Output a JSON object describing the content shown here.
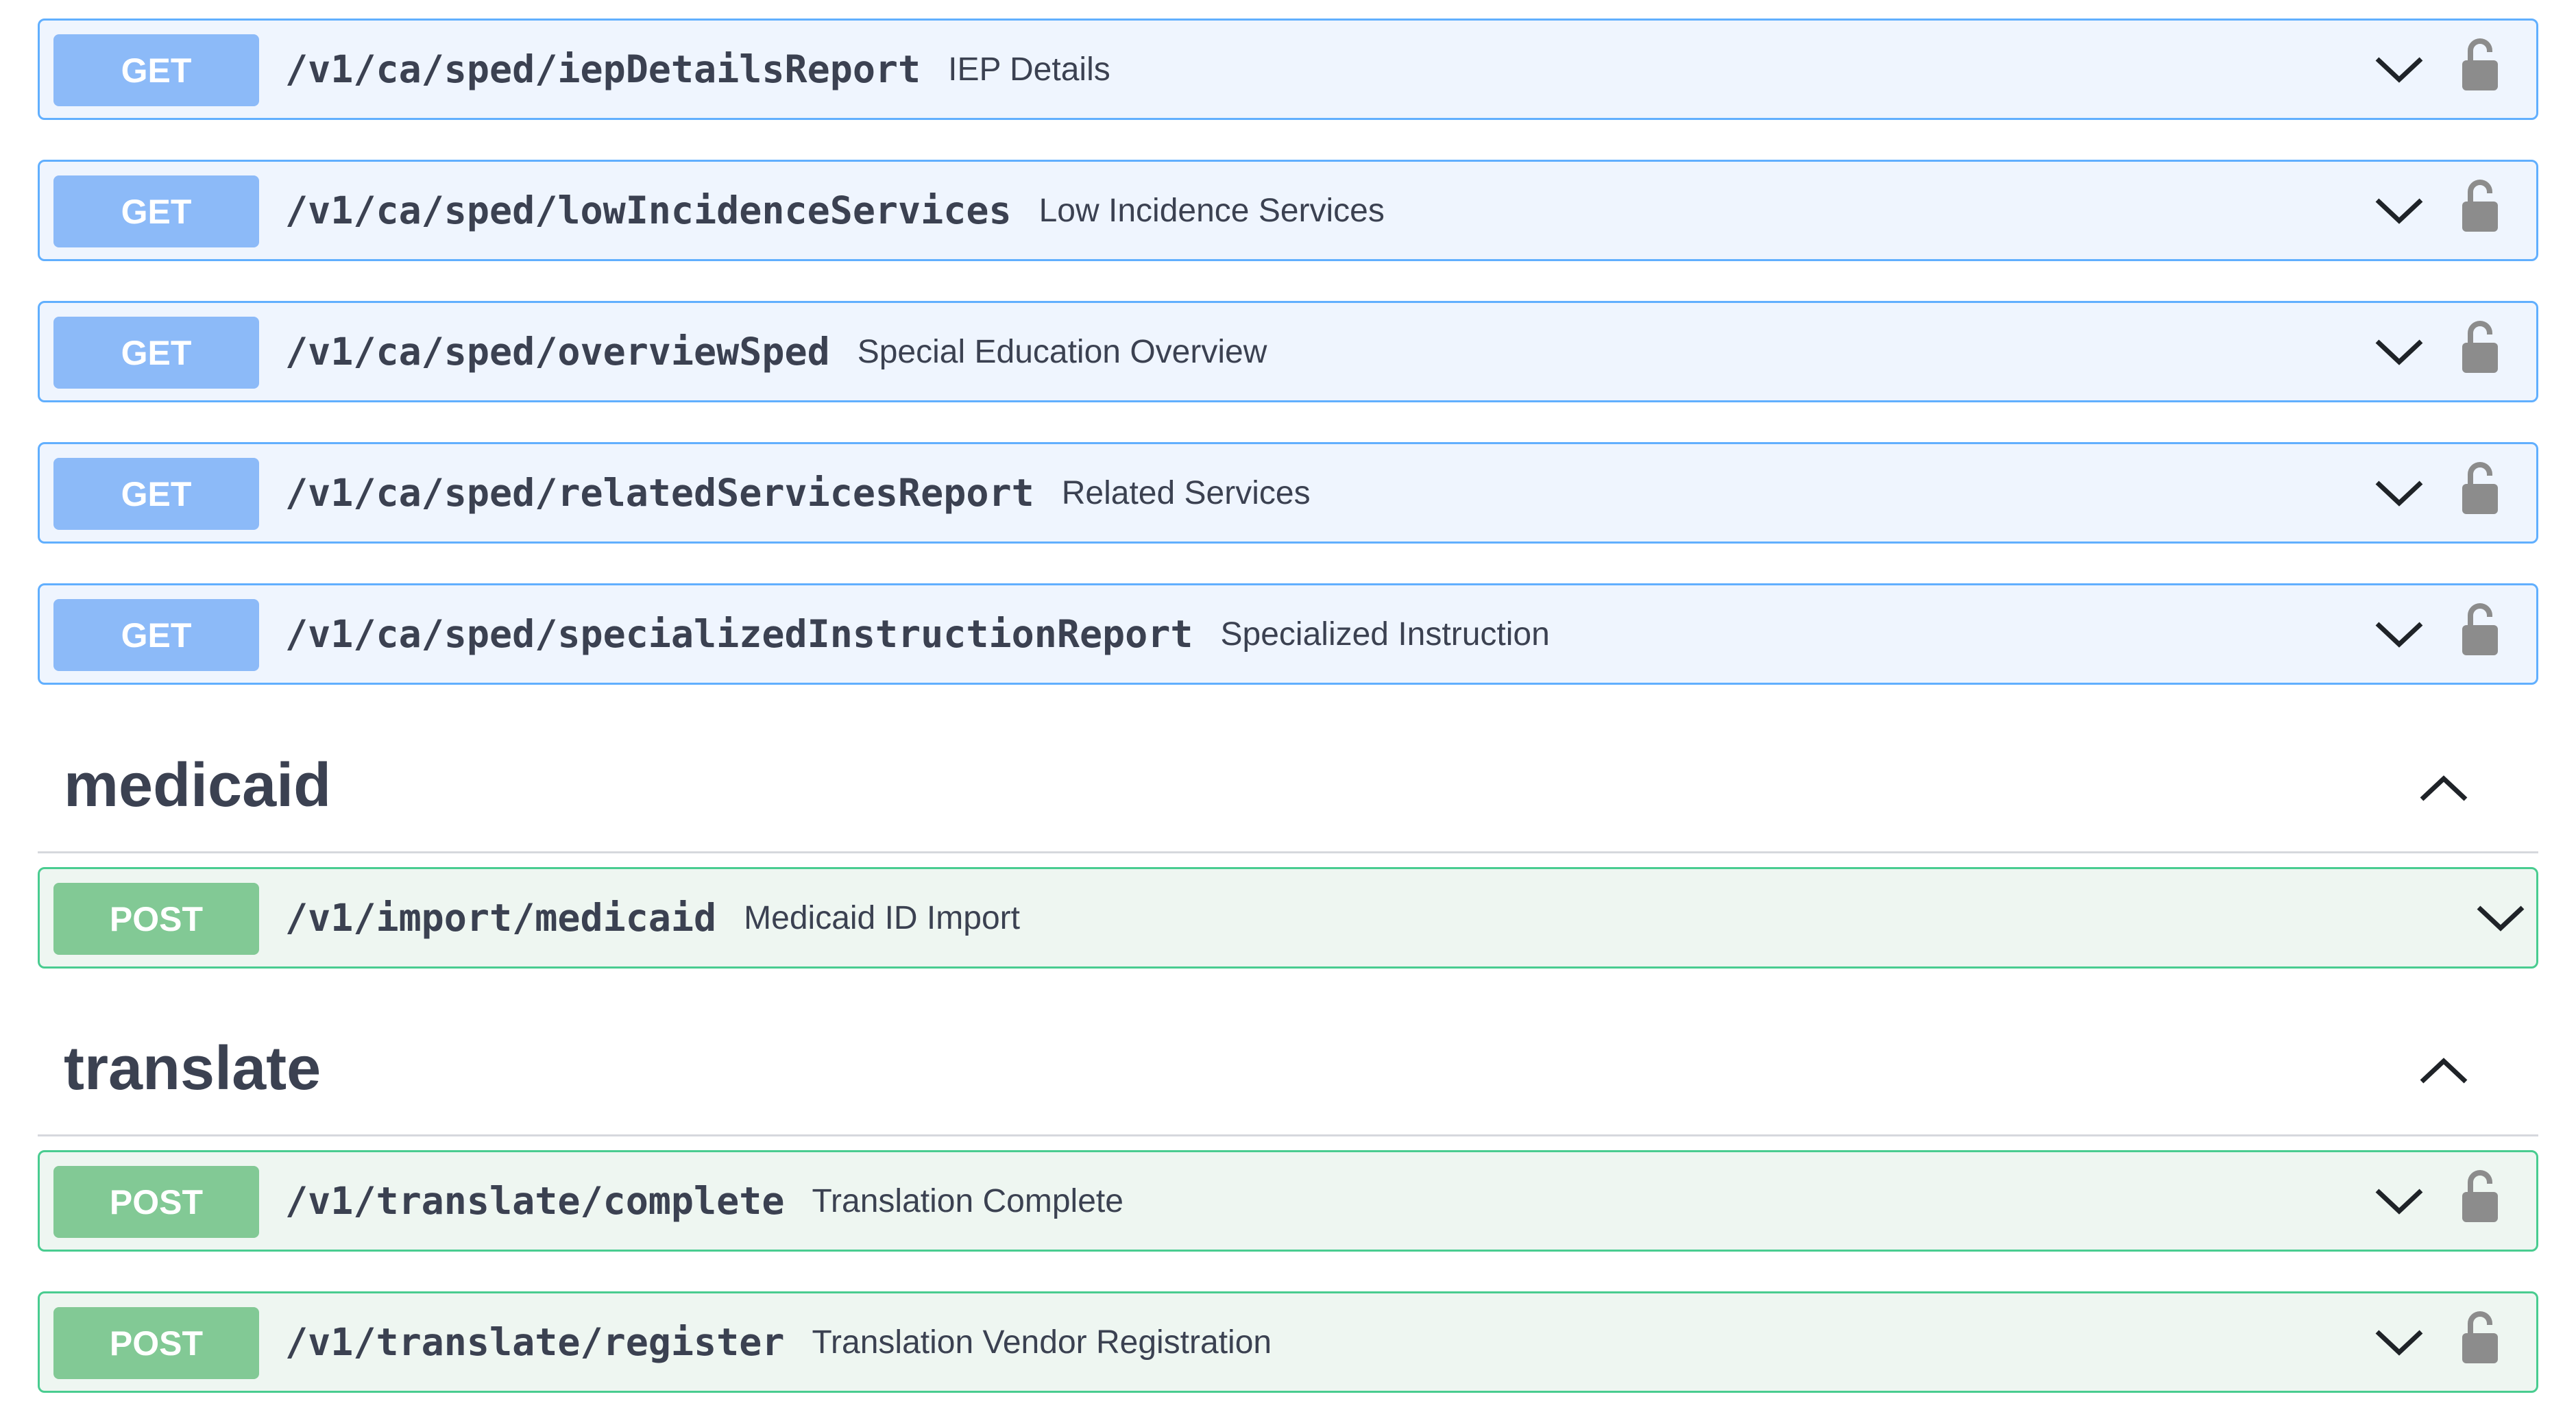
{
  "operations_top": [
    {
      "method": "GET",
      "path": "/v1/ca/sped/iepDetailsReport",
      "summary": "IEP Details",
      "locked": true
    },
    {
      "method": "GET",
      "path": "/v1/ca/sped/lowIncidenceServices",
      "summary": "Low Incidence Services",
      "locked": true
    },
    {
      "method": "GET",
      "path": "/v1/ca/sped/overviewSped",
      "summary": "Special Education Overview",
      "locked": true
    },
    {
      "method": "GET",
      "path": "/v1/ca/sped/relatedServicesReport",
      "summary": "Related Services",
      "locked": true
    },
    {
      "method": "GET",
      "path": "/v1/ca/sped/specializedInstructionReport",
      "summary": "Specialized Instruction",
      "locked": true
    }
  ],
  "sections": [
    {
      "title": "medicaid",
      "expanded": true,
      "operations": [
        {
          "method": "POST",
          "path": "/v1/import/medicaid",
          "summary": "Medicaid ID Import",
          "locked": false
        }
      ]
    },
    {
      "title": "translate",
      "expanded": true,
      "operations": [
        {
          "method": "POST",
          "path": "/v1/translate/complete",
          "summary": "Translation Complete",
          "locked": true
        },
        {
          "method": "POST",
          "path": "/v1/translate/register",
          "summary": "Translation Vendor Registration",
          "locked": true
        }
      ]
    }
  ],
  "colors": {
    "get_border": "#61affe",
    "get_bg": "#eff5fe",
    "get_badge": "#8cbaf8",
    "post_border": "#49cc90",
    "post_bg": "#eef6f1",
    "post_badge": "#82c995",
    "icon_gray": "#8c8c8c",
    "text": "#3b4151"
  }
}
